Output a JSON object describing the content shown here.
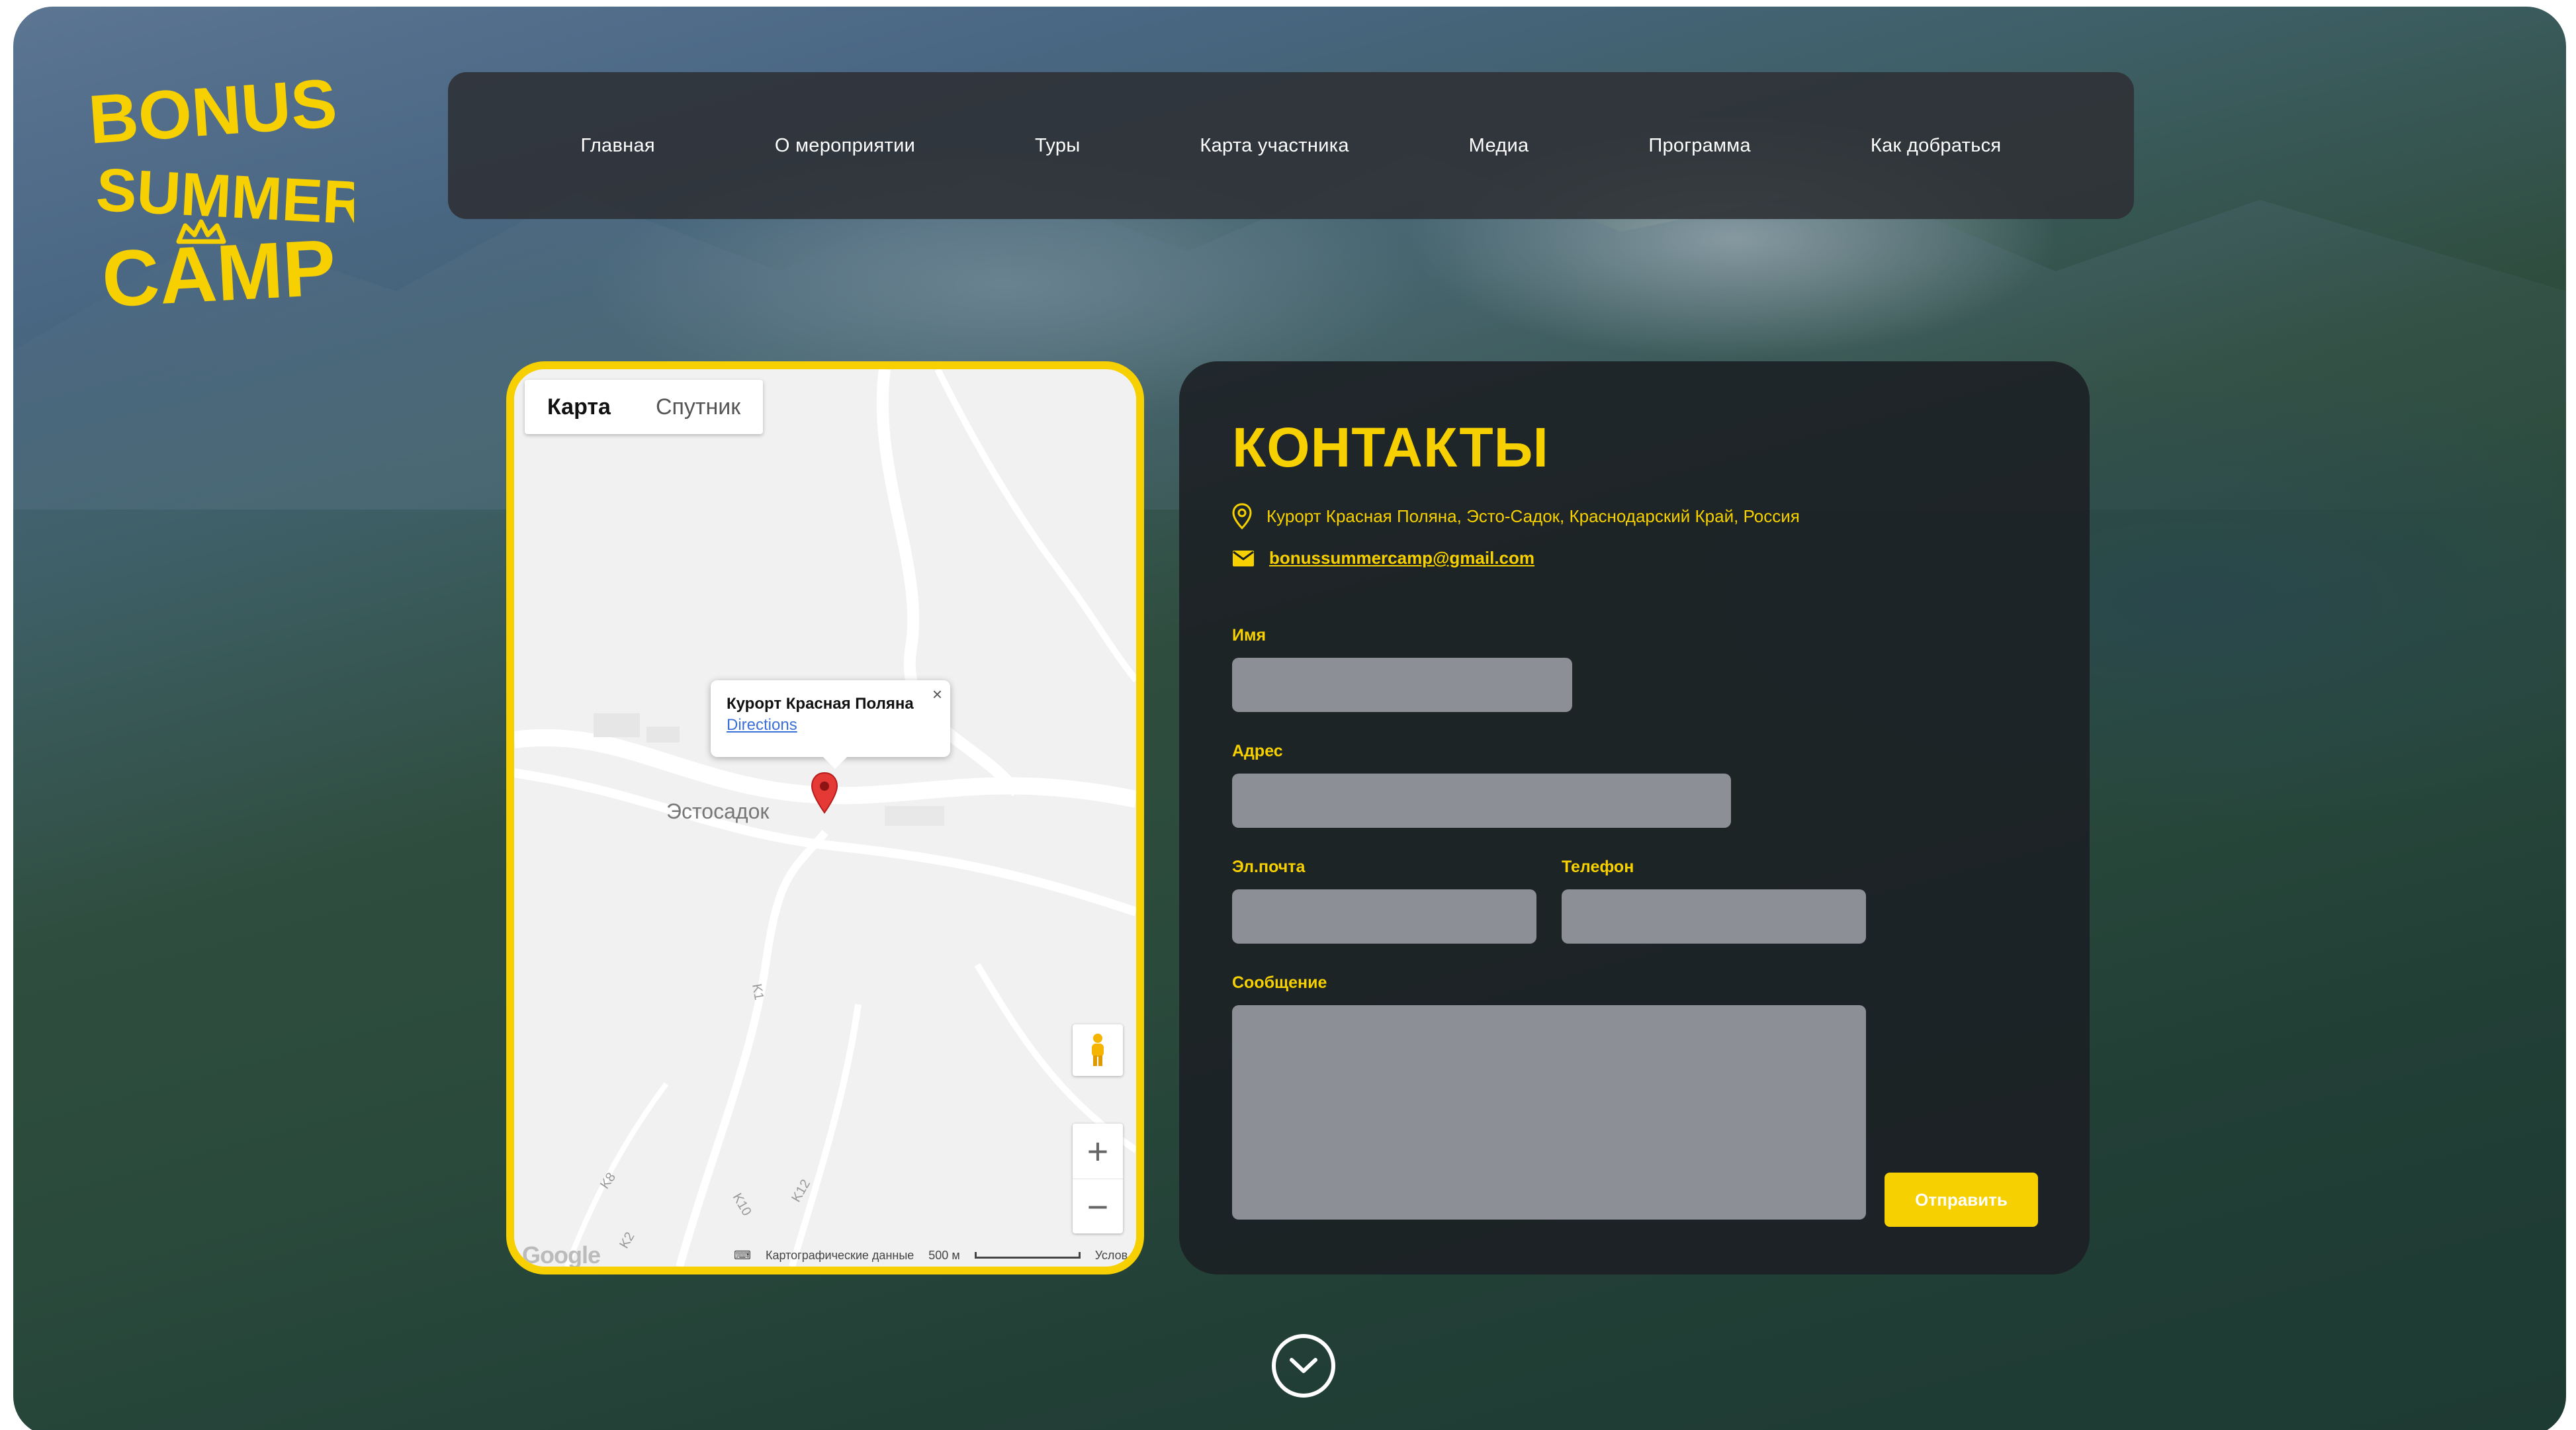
{
  "colors": {
    "accent": "#f6d000",
    "nav_bg": "#2d3034",
    "card_bg": "#1b1f23",
    "field_bg": "#8c8f95"
  },
  "logo": {
    "line1": "BONUS",
    "line2": "SUMMER",
    "line3": "CAMP"
  },
  "nav": {
    "items": [
      {
        "label": "Главная"
      },
      {
        "label": "О мероприятии"
      },
      {
        "label": "Туры"
      },
      {
        "label": "Карта участника"
      },
      {
        "label": "Медиа"
      },
      {
        "label": "Программа"
      },
      {
        "label": "Как добраться"
      }
    ]
  },
  "map": {
    "tabs": [
      {
        "label": "Карта"
      },
      {
        "label": "Спутник"
      }
    ],
    "popup": {
      "title": "Курорт Красная Поляна",
      "link": "Directions",
      "close": "×"
    },
    "place_label": "Эстосадок",
    "road_labels": [
      "K1",
      "K8",
      "K10",
      "K12",
      "K2"
    ],
    "zoom_in": "+",
    "zoom_out": "−",
    "footer": {
      "logo": "Google",
      "data": "Картографические данные",
      "scale": "500 м",
      "terms": "Услов"
    }
  },
  "contacts": {
    "title": "КОНТАКТЫ",
    "address": "Курорт Красная Поляна, Эсто-Садок, Краснодарский Край, Россия",
    "email": "bonussummercamp@gmail.com",
    "form": {
      "name_label": "Имя",
      "address_label": "Адрес",
      "email_label": "Эл.почта",
      "phone_label": "Телефон",
      "message_label": "Сообщение",
      "submit": "Отправить"
    }
  }
}
